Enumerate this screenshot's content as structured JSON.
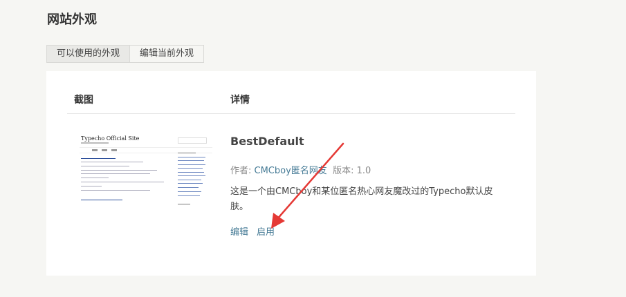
{
  "page": {
    "title": "网站外观"
  },
  "tabs": [
    {
      "label": "可以使用的外观",
      "active": true
    },
    {
      "label": "编辑当前外观",
      "active": false
    }
  ],
  "table": {
    "headers": [
      "截图",
      "详情"
    ]
  },
  "theme": {
    "name": "BestDefault",
    "author_label": "作者: ",
    "author": "CMCboy匿名网友",
    "version_label": "版本: ",
    "version": "1.0",
    "description": "这是一个由CMCboy和某位匿名热心网友魔改过的Typecho默认皮肤。",
    "actions": {
      "edit": "编辑",
      "activate": "启用"
    },
    "thumbnail": {
      "site_title": "Typecho Official Site"
    }
  },
  "colors": {
    "link": "#467b96",
    "arrow": "#e53935",
    "background": "#f6f6f3"
  }
}
